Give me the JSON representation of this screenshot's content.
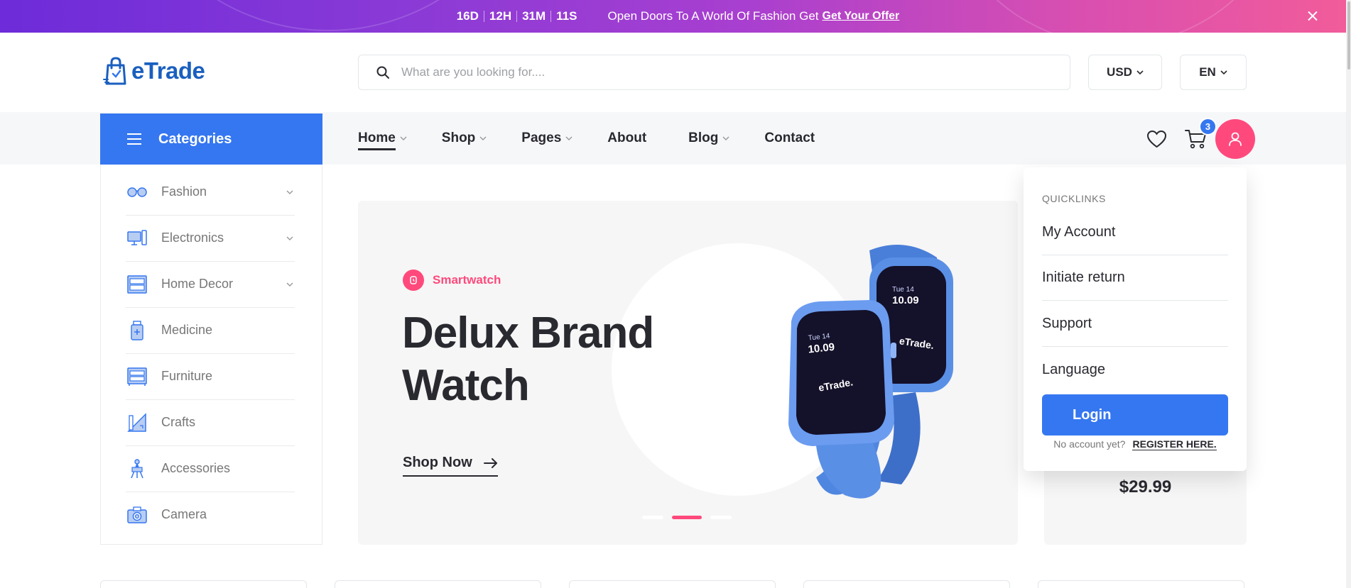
{
  "promo": {
    "countdown": [
      "16D",
      "12H",
      "31M",
      "11S"
    ],
    "text": "Open Doors To A World Of Fashion Get",
    "link": "Get Your Offer"
  },
  "header": {
    "logo": "eTrade",
    "search_placeholder": "What are you looking for....",
    "currency": "USD",
    "language": "EN"
  },
  "nav": {
    "categories_label": "Categories",
    "menu": [
      {
        "label": "Home",
        "dropdown": true,
        "active": true
      },
      {
        "label": "Shop",
        "dropdown": true
      },
      {
        "label": "Pages",
        "dropdown": true
      },
      {
        "label": "About",
        "dropdown": false
      },
      {
        "label": "Blog",
        "dropdown": true
      },
      {
        "label": "Contact",
        "dropdown": false
      }
    ],
    "cart_count": "3"
  },
  "sidebar": {
    "items": [
      {
        "label": "Fashion",
        "icon": "glasses-icon",
        "has_sub": true
      },
      {
        "label": "Electronics",
        "icon": "computer-icon",
        "has_sub": true
      },
      {
        "label": "Home Decor",
        "icon": "drawer-icon",
        "has_sub": true
      },
      {
        "label": "Medicine",
        "icon": "medicine-bottle-icon",
        "has_sub": false
      },
      {
        "label": "Furniture",
        "icon": "cabinet-icon",
        "has_sub": false
      },
      {
        "label": "Crafts",
        "icon": "ruler-pencil-icon",
        "has_sub": false
      },
      {
        "label": "Accessories",
        "icon": "easel-icon",
        "has_sub": false
      },
      {
        "label": "Camera",
        "icon": "camera-icon",
        "has_sub": false
      }
    ]
  },
  "hero": {
    "tag": "Smartwatch",
    "title": "Delux Brand Watch",
    "cta": "Shop Now",
    "watch_brand": "eTrade.",
    "watch_time": "10.09",
    "watch_date": "Tue 14",
    "slide_active": 2,
    "slide_count": 3
  },
  "side_product": {
    "price": "$29.99"
  },
  "quicklinks": {
    "heading": "QUICKLINKS",
    "links": [
      "My Account",
      "Initiate return",
      "Support",
      "Language"
    ],
    "login": "Login",
    "no_account": "No account yet?",
    "register": "REGISTER HERE."
  },
  "colors": {
    "primary": "#3577f0",
    "accent": "#ff497c",
    "text": "#292930",
    "muted": "#777777"
  }
}
